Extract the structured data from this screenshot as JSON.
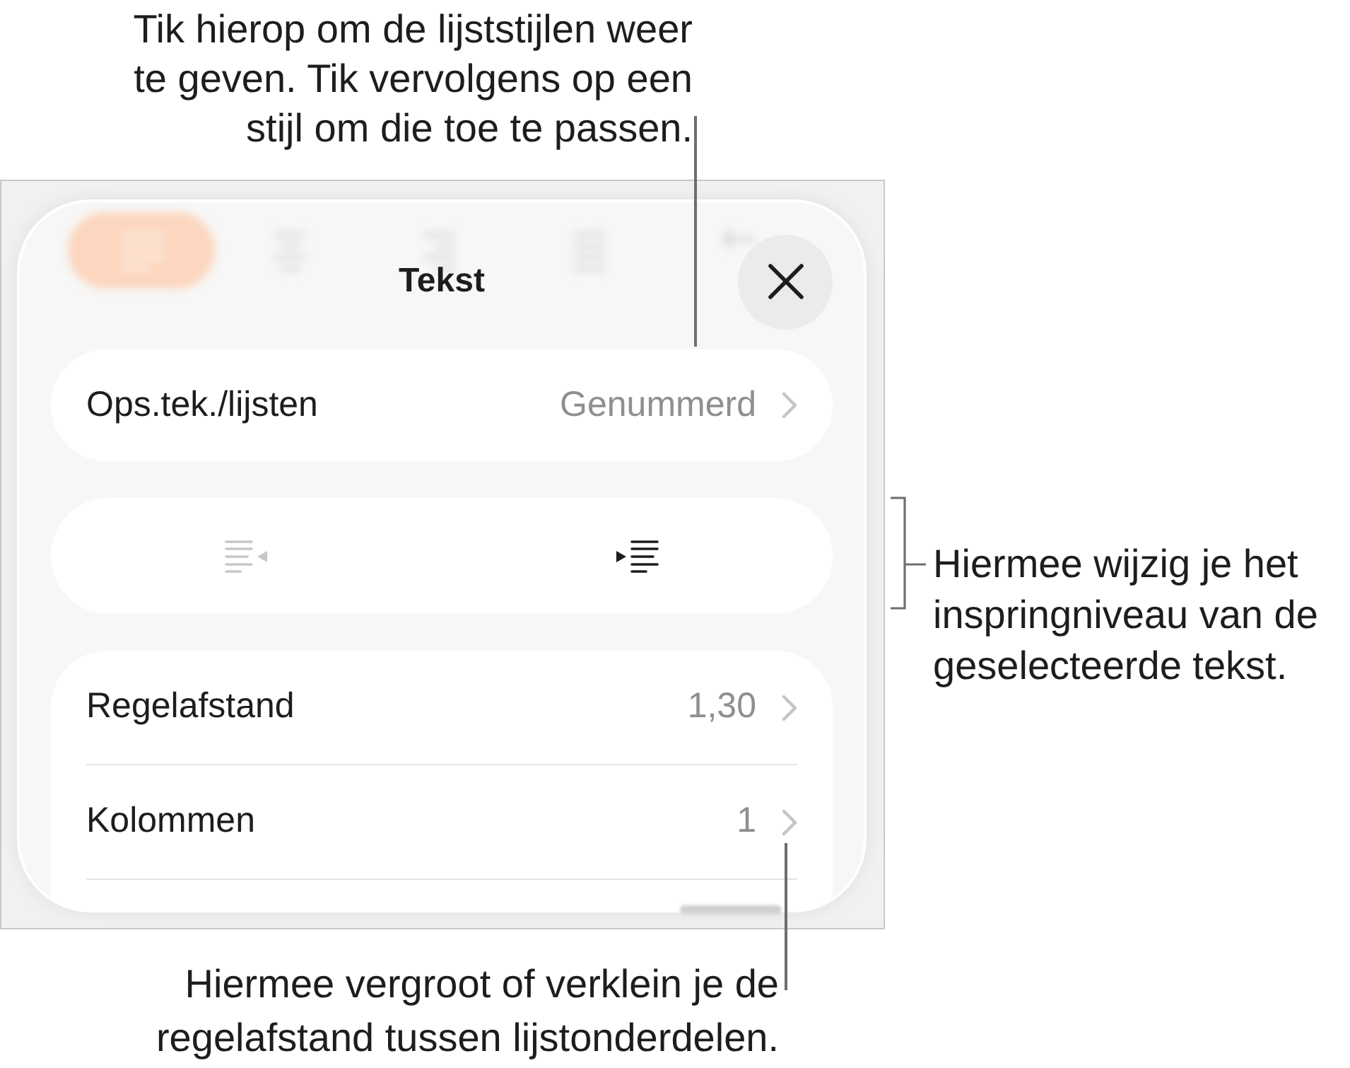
{
  "callouts": {
    "list_style": "Tik hierop om de lijststijlen weer te geven. Tik vervolgens op een stijl om die toe te passen.",
    "indent": "Hiermee wijzig je het inspringniveau van de geselecteerde tekst.",
    "spacing": "Hiermee vergroot of verklein je de regelafstand tussen lijstonderdelen."
  },
  "panel": {
    "title": "Tekst",
    "list_style": {
      "label": "Ops.tek./lijsten",
      "value": "Genummerd"
    },
    "indent_buttons": [
      {
        "kind": "decrease",
        "disabled": true
      },
      {
        "kind": "increase",
        "disabled": false
      }
    ],
    "rows": [
      {
        "label": "Regelafstand",
        "value": "1,30"
      },
      {
        "label": "Kolommen",
        "value": "1"
      }
    ]
  }
}
